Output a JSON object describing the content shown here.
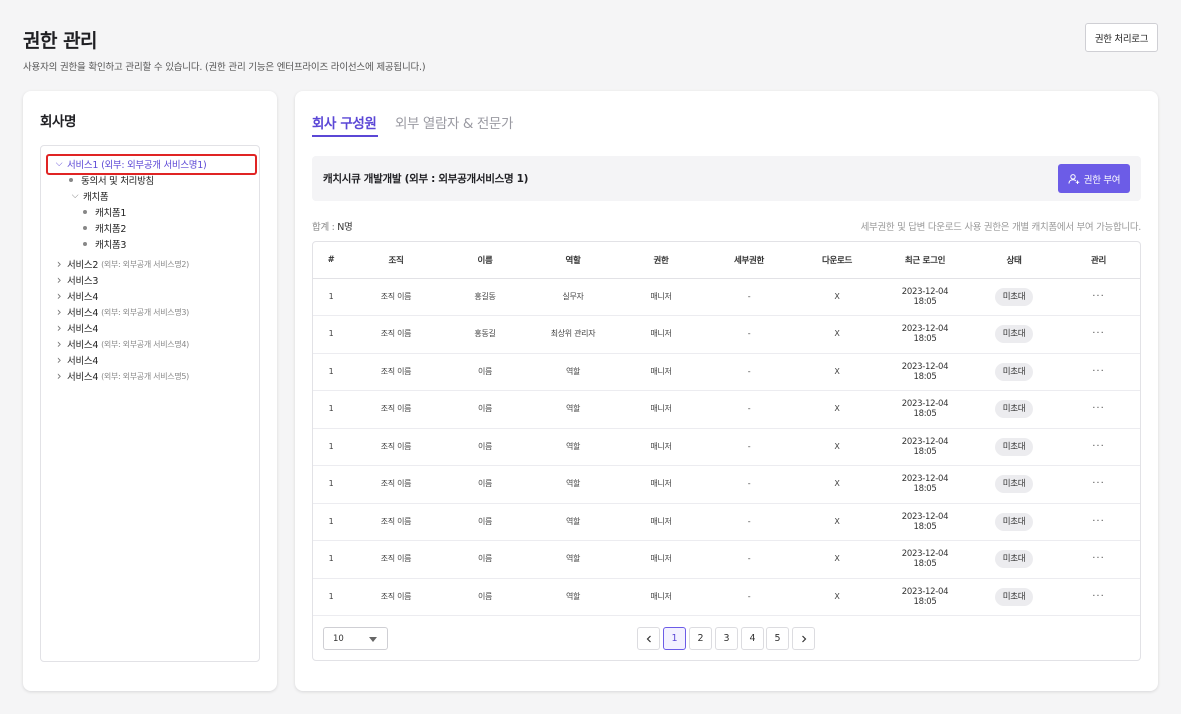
{
  "page": {
    "title": "권한 관리",
    "description": "사용자의 권한을 확인하고 관리할 수 있습니다. (권한 관리 기능은 엔터프라이즈 라이선스에 제공됩니다.)",
    "log_button": "권한 처리로그"
  },
  "sidebar": {
    "title": "회사명",
    "tree": [
      {
        "label": "서비스1",
        "sub": "(외부: 외부공개 서비스명1)",
        "type": "expanded",
        "selected": true
      },
      {
        "label": "동의서 및 처리방침",
        "type": "dot"
      },
      {
        "label": "캐치폼",
        "type": "expanded"
      },
      {
        "label": "캐치폼1",
        "type": "dot"
      },
      {
        "label": "캐치폼2",
        "type": "dot"
      },
      {
        "label": "캐치폼3",
        "type": "dot"
      },
      {
        "label": "서비스2",
        "sub": "(외부: 외부공개 서비스명2)",
        "type": "collapsed"
      },
      {
        "label": "서비스3",
        "type": "collapsed"
      },
      {
        "label": "서비스4",
        "type": "collapsed"
      },
      {
        "label": "서비스4",
        "sub": "(외부: 외부공개 서비스명3)",
        "type": "collapsed"
      },
      {
        "label": "서비스4",
        "type": "collapsed"
      },
      {
        "label": "서비스4",
        "sub": "(외부: 외부공개 서비스명4)",
        "type": "collapsed"
      },
      {
        "label": "서비스4",
        "type": "collapsed"
      },
      {
        "label": "서비스4",
        "sub": "(외부: 외부공개 서비스명5)",
        "type": "collapsed"
      }
    ]
  },
  "main": {
    "tabs": [
      {
        "label": "회사 구성원",
        "active": true
      },
      {
        "label": "외부 열람자 & 전문가",
        "active": false
      }
    ],
    "header_title": "캐치시큐 개발개발 (외부 : 외부공개서비스명 1)",
    "grant_button": "권한 부여",
    "total_label": "합계 :",
    "total_value": "N명",
    "note": "세부권한 및 답변 다운로드 사용 권한은 개별 캐치폼에서 부여 가능합니다.",
    "columns": [
      "#",
      "조직",
      "이름",
      "역할",
      "권한",
      "세부권한",
      "다운로드",
      "최근 로그인",
      "상태",
      "관리"
    ],
    "rows": [
      {
        "no": "1",
        "org": "조직 이름",
        "name": "홍길동",
        "role": "실무자",
        "perm": "매니저",
        "detail": "-",
        "download": "X",
        "date": "2023-12-04",
        "time": "18:05",
        "status": "미초대"
      },
      {
        "no": "1",
        "org": "조직 이름",
        "name": "홍동길",
        "role": "최상위 관리자",
        "perm": "매니저",
        "detail": "-",
        "download": "X",
        "date": "2023-12-04",
        "time": "18:05",
        "status": "미초대"
      },
      {
        "no": "1",
        "org": "조직 이름",
        "name": "이름",
        "role": "역할",
        "perm": "매니저",
        "detail": "-",
        "download": "X",
        "date": "2023-12-04",
        "time": "18:05",
        "status": "미초대"
      },
      {
        "no": "1",
        "org": "조직 이름",
        "name": "이름",
        "role": "역할",
        "perm": "매니저",
        "detail": "-",
        "download": "X",
        "date": "2023-12-04",
        "time": "18:05",
        "status": "미초대"
      },
      {
        "no": "1",
        "org": "조직 이름",
        "name": "이름",
        "role": "역할",
        "perm": "매니저",
        "detail": "-",
        "download": "X",
        "date": "2023-12-04",
        "time": "18:05",
        "status": "미초대"
      },
      {
        "no": "1",
        "org": "조직 이름",
        "name": "이름",
        "role": "역할",
        "perm": "매니저",
        "detail": "-",
        "download": "X",
        "date": "2023-12-04",
        "time": "18:05",
        "status": "미초대"
      },
      {
        "no": "1",
        "org": "조직 이름",
        "name": "이름",
        "role": "역할",
        "perm": "매니저",
        "detail": "-",
        "download": "X",
        "date": "2023-12-04",
        "time": "18:05",
        "status": "미초대"
      },
      {
        "no": "1",
        "org": "조직 이름",
        "name": "이름",
        "role": "역할",
        "perm": "매니저",
        "detail": "-",
        "download": "X",
        "date": "2023-12-04",
        "time": "18:05",
        "status": "미초대"
      },
      {
        "no": "1",
        "org": "조직 이름",
        "name": "이름",
        "role": "역할",
        "perm": "매니저",
        "detail": "-",
        "download": "X",
        "date": "2023-12-04",
        "time": "18:05",
        "status": "미초대"
      }
    ],
    "manage_glyph": "···",
    "pagination": {
      "page_size": "10",
      "pages": [
        "1",
        "2",
        "3",
        "4",
        "5"
      ],
      "current": "1",
      "prev_icon": "chevron-left-icon",
      "next_icon": "chevron-right-icon"
    }
  },
  "colors": {
    "accent": "#5b47d6",
    "button": "#6c5ce7",
    "highlight_outline": "#e02424"
  }
}
